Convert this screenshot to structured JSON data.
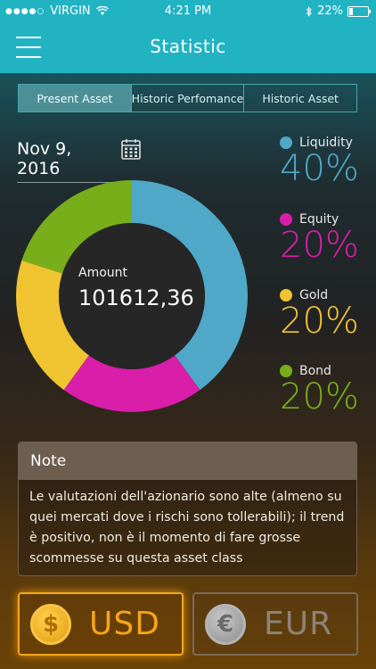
{
  "status": {
    "carrier": "VIRGIN",
    "time": "4:21 PM",
    "battery": "22%",
    "battery_level": 0.22,
    "icons": [
      "signal-dots-icon",
      "wifi-icon",
      "bluetooth-icon",
      "battery-icon"
    ]
  },
  "nav": {
    "title": "Statistic",
    "menu_icon": "hamburger-menu-icon"
  },
  "tabs": [
    {
      "label": "Present Asset",
      "active": true
    },
    {
      "label": "Historic Perfomance",
      "active": false
    },
    {
      "label": "Historic Asset",
      "active": false
    }
  ],
  "date": {
    "value": "Nov 9, 2016",
    "icon": "calendar-icon"
  },
  "chart_data": {
    "type": "pie",
    "center_label": "Amount",
    "center_value": "101612,36",
    "categories": [
      "Liquidity",
      "Equity",
      "Gold",
      "Bond"
    ],
    "values": [
      40,
      20,
      20,
      20
    ],
    "labels": [
      "40%",
      "20%",
      "20%",
      "20%"
    ],
    "colors": [
      "#4fa8c8",
      "#d91eaa",
      "#f0c431",
      "#78ae1a"
    ]
  },
  "note": {
    "title": "Note",
    "text": "Le valutazioni dell'azionario sono alte (almeno su quei mercati dove i rischi sono tollerabili); il trend è positivo, non è il momento di fare grosse scommesse su questa asset class"
  },
  "currencies": [
    {
      "label": "USD",
      "symbol": "$",
      "icon": "dollar-coin-icon",
      "active": true
    },
    {
      "label": "EUR",
      "symbol": "€",
      "icon": "euro-coin-icon",
      "active": false
    }
  ]
}
